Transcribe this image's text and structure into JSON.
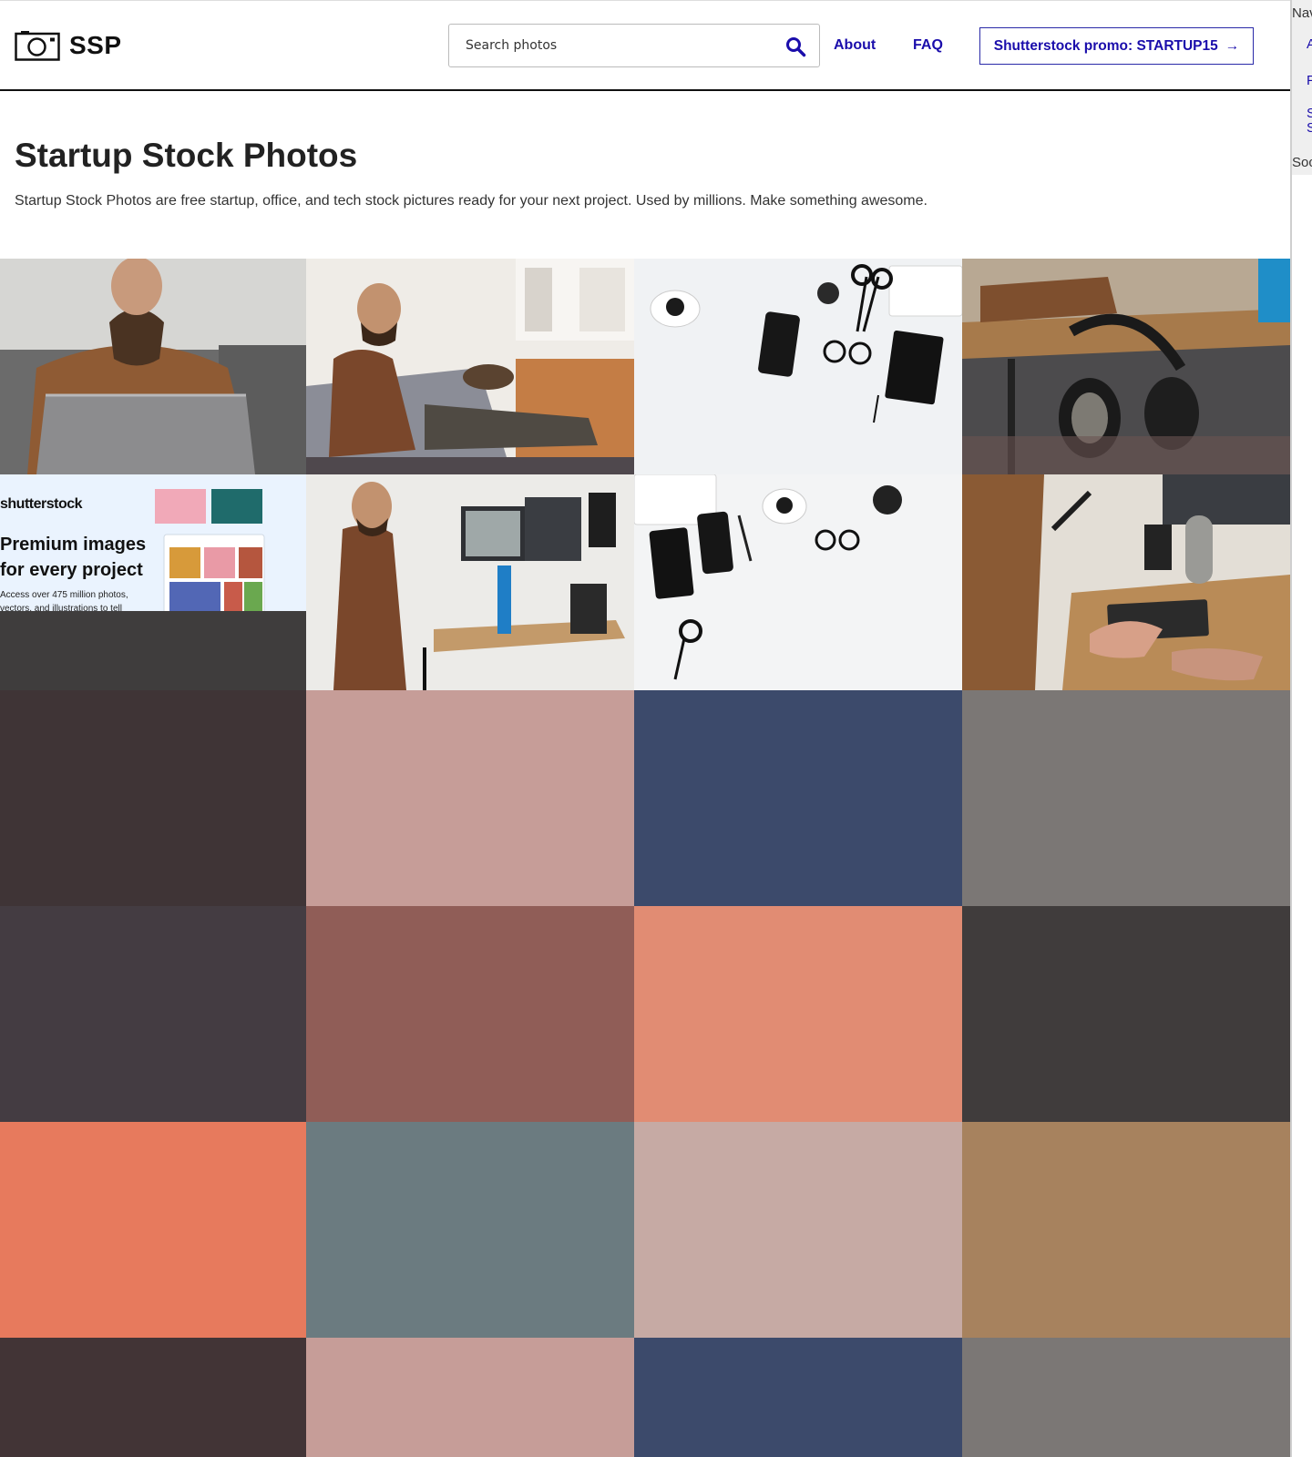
{
  "header": {
    "logo_text": "SSP",
    "search_placeholder": "Search photos",
    "nav": {
      "about": "About",
      "faq": "FAQ"
    },
    "promo_label": "Shutterstock promo: STARTUP15",
    "promo_arrow": "→"
  },
  "hero": {
    "title": "Startup Stock Photos",
    "description": "Startup Stock Photos are free startup, office, and tech stock pictures ready for your next project. Used by millions. Make something awesome."
  },
  "ad": {
    "brand": "shutterstock",
    "headline": "Premium images for every project",
    "subtext": "Access over 475 million photos, vectors, and illustrations to tell"
  },
  "side_panel": {
    "nav_title": "Nav",
    "link_a": "A",
    "link_f": "F",
    "link_s1": "S",
    "link_s2": "S",
    "social_title": "Soc"
  },
  "photos": [
    {
      "name": "photo-man-laptop-couch",
      "colors": [
        "#cfcfcc",
        "#8b5a36",
        "#656565"
      ]
    },
    {
      "name": "photo-man-phone-dog-couch",
      "colors": [
        "#e6e2dc",
        "#7a4a2c",
        "#4a4a52"
      ]
    },
    {
      "name": "photo-desk-flatlay-scissors",
      "colors": [
        "#eef0f2",
        "#141414",
        "#ffffff"
      ]
    },
    {
      "name": "photo-headphones-desk",
      "colors": [
        "#b5a58f",
        "#1f1f1f",
        "#7b5534"
      ]
    },
    {
      "name": "photo-man-standing-desk-monitors",
      "colors": [
        "#eae7e3",
        "#7a4a2c",
        "#2a2a2e"
      ]
    },
    {
      "name": "photo-desk-flatlay-keyboard",
      "colors": [
        "#f3f4f5",
        "#151515",
        "#ffffff"
      ]
    },
    {
      "name": "photo-hands-keyboard-microphone",
      "colors": [
        "#c9b79f",
        "#8a5a34",
        "#2b2b2b"
      ]
    }
  ],
  "placeholder_tiles": [
    "#3f3436",
    "#c69d98",
    "#3c4a6b",
    "#7b7775",
    "#443c42",
    "#905d57",
    "#e18c73",
    "#403c3c",
    "#e77a5d",
    "#6b7b80",
    "#c6aaa4",
    "#a7825e",
    "#423436",
    "#c69d98",
    "#3c4a6b",
    "#7b7775"
  ],
  "ad_placeholder_color": "#3f3d3d"
}
